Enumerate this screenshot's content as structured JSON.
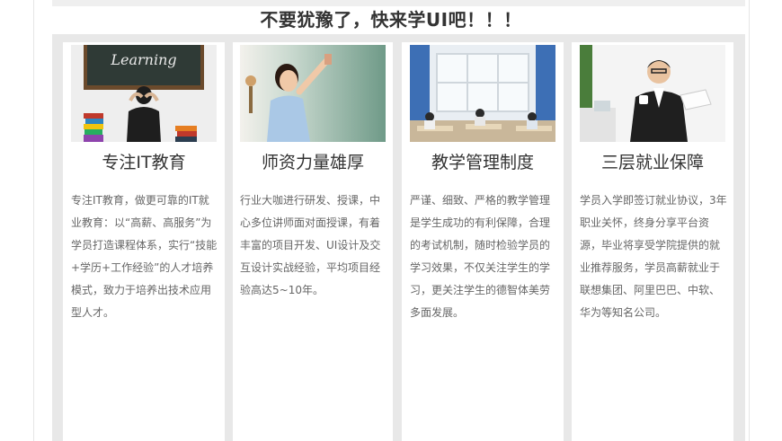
{
  "headline": "不要犹豫了，快来学UI吧！！！",
  "cards": [
    {
      "title": "专注IT教育",
      "description": "专注IT教育，做更可靠的IT就业教育：以“高薪、高服务”为学员打造课程体系，实行“技能+学历+工作经验”的人才培养模式，致力于培养出技术应用型人才。",
      "image_text": "Learning"
    },
    {
      "title": "师资力量雄厚",
      "description": "行业大咖进行研发、授课，中心多位讲师面对面授课，有着丰富的项目开发、UI设计及交互设计实战经验，平均项目经验高达5~10年。"
    },
    {
      "title": "教学管理制度",
      "description": "严谨、细致、严格的教学管理是学生成功的有利保障，合理的考试机制，随时检验学员的学习效果，不仅关注学生的学习，更关注学生的德智体美劳多面发展。"
    },
    {
      "title": "三层就业保障",
      "description": "学员入学即签订就业协议，3年职业关怀，终身分享平台资源，毕业将享受学院提供的就业推荐服务，学员高薪就业于联想集团、阿里巴巴、中软、华为等知名公司。"
    }
  ]
}
